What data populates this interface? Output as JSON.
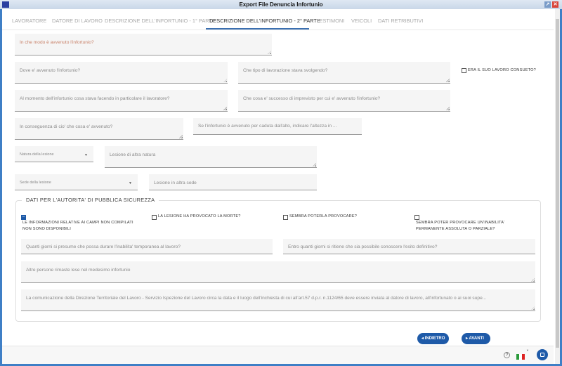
{
  "window": {
    "title": "Export File Denuncia Infortunio"
  },
  "tabs": [
    {
      "label": "LAVORATORE"
    },
    {
      "label": "DATORE DI LAVORO"
    },
    {
      "label": "DESCRIZIONE DELL'INFORTUNIO - 1° PARTE"
    },
    {
      "label": "DESCRIZIONE DELL'INFORTUNIO - 2° PARTE",
      "active": true
    },
    {
      "label": "TESTIMONI"
    },
    {
      "label": "VEICOLI"
    },
    {
      "label": "DATI RETRIBUTIVI"
    }
  ],
  "fields": {
    "come": "In che modo è avvenuto l'infortunio?",
    "dove": "Dove e' avvenuto l'infortunio?",
    "lavorazione": "Che tipo di lavorazione stava svolgendo?",
    "consueto": "ERA IL SUO LAVORO CONSUETO?",
    "momento": "Al momento dell'infortunio cosa stava facendo in particolare il lavoratore?",
    "imprevisto": "Che cosa e' successo di imprevisto per cui e' avvenuto l'infortunio?",
    "conseguenza": "In conseguenza di cio' che cosa e' avvenuto?",
    "altezza": "Se l'infortunio è avvenuto per caduta dall'alto, indicare l'altezza in ...",
    "natura": "Natura della lesione",
    "altra_natura": "Lesione di altra natura",
    "sede": "Sede della lesione",
    "altra_sede": "Lesione in altra sede"
  },
  "sicurezza": {
    "legend": "DATI PER L'AUTORITA' DI PUBBLICA SICUREZZA",
    "cb1_l1": "LE INFORMAZIONI RELATIVE AI CAMPI NON COMPILATI",
    "cb1_l2": "NON SONO DISPONIBILI",
    "cb1_checked": true,
    "cb2": "LA LESIONE HA PROVOCATO LA MORTE?",
    "cb3": "SEMBRA POTERLA PROVOCARE?",
    "cb4_l1": "SEMBRA POTER PROVOCARE UN'INABILITA'",
    "cb4_l2": "PERMANENTE ASSOLUTA O PARZIALE?",
    "giorni_temp": "Quanti giorni si presume che possa durare l'inabilita' temporanea al lavoro?",
    "giorni_esito": "Entro quanti giorni si ritiene che sia possibile conoscere l'esito definitivo?",
    "altre_persone": "Altre persone rimaste lese nel medesimo infortunio",
    "comunicazione": "La comunicazione della Direzione Territoriale del Lavoro - Servizio Ispezione del Lavoro circa la data e il luogo dell'inchiesta di cui all'art.57 d.p.r. n.1124/65 deve essere inviata al datore di lavoro, all'infortunato o ai suoi supe..."
  },
  "buttons": {
    "back": "INDIETRO",
    "next": "AVANTI"
  },
  "footer": {
    "help": "?",
    "language": "it"
  },
  "colors": {
    "accent": "#1e5aa8"
  }
}
